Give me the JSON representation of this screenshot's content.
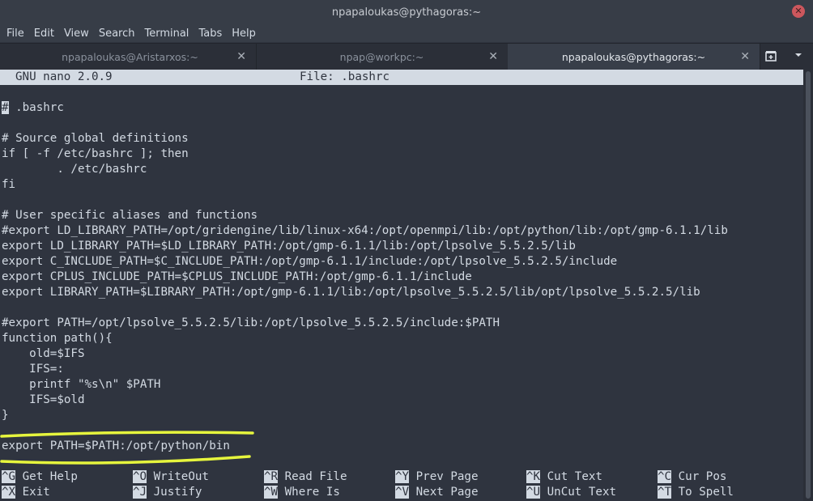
{
  "window": {
    "title": "npapaloukas@pythagoras:~",
    "close_label": "✕"
  },
  "menubar": {
    "items": [
      "File",
      "Edit",
      "View",
      "Search",
      "Terminal",
      "Tabs",
      "Help"
    ]
  },
  "tabs": [
    {
      "label": "npapaloukas@Aristarxos:~",
      "active": false
    },
    {
      "label": "npap@workpc:~",
      "active": false
    },
    {
      "label": "npapaloukas@pythagoras:~",
      "active": true
    }
  ],
  "nano": {
    "version": "GNU nano 2.0.9",
    "file": "File: .bashrc",
    "cursor_char": "#",
    "lines": [
      " .bashrc",
      "",
      "# Source global definitions",
      "if [ -f /etc/bashrc ]; then",
      "        . /etc/bashrc",
      "fi",
      "",
      "# User specific aliases and functions",
      "#export LD_LIBRARY_PATH=/opt/gridengine/lib/linux-x64:/opt/openmpi/lib:/opt/python/lib:/opt/gmp-6.1.1/lib",
      "export LD_LIBRARY_PATH=$LD_LIBRARY_PATH:/opt/gmp-6.1.1/lib:/opt/lpsolve_5.5.2.5/lib",
      "export C_INCLUDE_PATH=$C_INCLUDE_PATH:/opt/gmp-6.1.1/include:/opt/lpsolve_5.5.2.5/include",
      "export CPLUS_INCLUDE_PATH=$CPLUS_INCLUDE_PATH:/opt/gmp-6.1.1/include",
      "export LIBRARY_PATH=$LIBRARY_PATH:/opt/gmp-6.1.1/lib:/opt/lpsolve_5.5.2.5/lib/opt/lpsolve_5.5.2.5/lib",
      "",
      "#export PATH=/opt/lpsolve_5.5.2.5/lib:/opt/lpsolve_5.5.2.5/include:$PATH",
      "function path(){",
      "    old=$IFS",
      "    IFS=:",
      "    printf \"%s\\n\" $PATH",
      "    IFS=$old",
      "}",
      "",
      "export PATH=$PATH:/opt/python/bin"
    ],
    "shortcuts_row1": [
      {
        "key": "^G",
        "label": "Get Help"
      },
      {
        "key": "^O",
        "label": "WriteOut"
      },
      {
        "key": "^R",
        "label": "Read File"
      },
      {
        "key": "^Y",
        "label": "Prev Page"
      },
      {
        "key": "^K",
        "label": "Cut Text"
      },
      {
        "key": "^C",
        "label": "Cur Pos"
      }
    ],
    "shortcuts_row2": [
      {
        "key": "^X",
        "label": "Exit"
      },
      {
        "key": "^J",
        "label": "Justify"
      },
      {
        "key": "^W",
        "label": "Where Is"
      },
      {
        "key": "^V",
        "label": "Next Page"
      },
      {
        "key": "^U",
        "label": "UnCut Text"
      },
      {
        "key": "^T",
        "label": "To Spell"
      }
    ]
  },
  "colors": {
    "background": "#2f343f",
    "foreground": "#d3dae3",
    "highlight": "#e6f53d",
    "close_button": "#cc575d"
  }
}
